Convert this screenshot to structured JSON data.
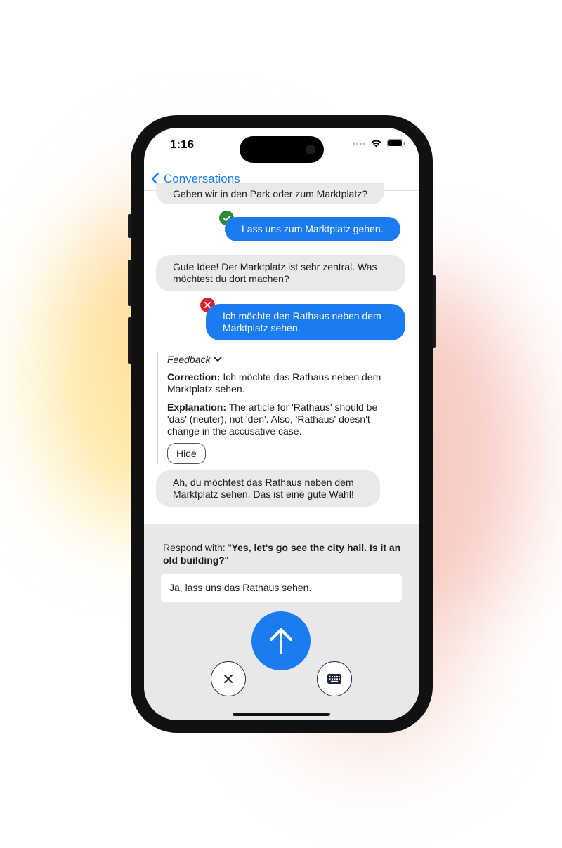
{
  "status_bar": {
    "time": "1:16"
  },
  "nav": {
    "back_label": "Conversations"
  },
  "messages": [
    {
      "role": "bot",
      "text": "Gehen wir in den Park oder zum Marktplatz?"
    },
    {
      "role": "user",
      "text": "Lass uns zum Marktplatz gehen.",
      "status": "correct"
    },
    {
      "role": "bot",
      "text": "Gute Idee! Der Marktplatz ist sehr zentral. Was möchtest du dort machen?"
    },
    {
      "role": "user",
      "text": "Ich möchte den Rathaus neben dem Marktplatz sehen.",
      "status": "incorrect"
    },
    {
      "role": "bot",
      "text": "Ah, du möchtest das Rathaus neben dem Marktplatz sehen. Das ist eine gute Wahl!"
    }
  ],
  "feedback": {
    "title": "Feedback",
    "correction_label": "Correction:",
    "correction_text": "Ich möchte das Rathaus neben dem Marktplatz sehen.",
    "explanation_label": "Explanation:",
    "explanation_text": "The article for 'Rathaus' should be 'das' (neuter), not 'den'. Also, 'Rathaus' doesn't change in the accusative case.",
    "hide_label": "Hide"
  },
  "prompt": {
    "prefix": "Respond with: \"",
    "target": "Yes, let's go see the city hall. Is it an old building?",
    "suffix": "\""
  },
  "input": {
    "value": "Ja, lass uns das Rathaus sehen."
  },
  "icons": {
    "back": "chevron-left-icon",
    "send": "arrow-up-icon",
    "cancel": "close-icon",
    "keyboard": "keyboard-icon",
    "correct": "checkmark-icon",
    "incorrect": "x-mark-icon"
  },
  "colors": {
    "accent": "#1a7cf0",
    "bot_bubble": "#e9e9eb",
    "correct": "#2e8a3a",
    "incorrect": "#e0202a",
    "bottom_panel": "#e8e8ea"
  }
}
